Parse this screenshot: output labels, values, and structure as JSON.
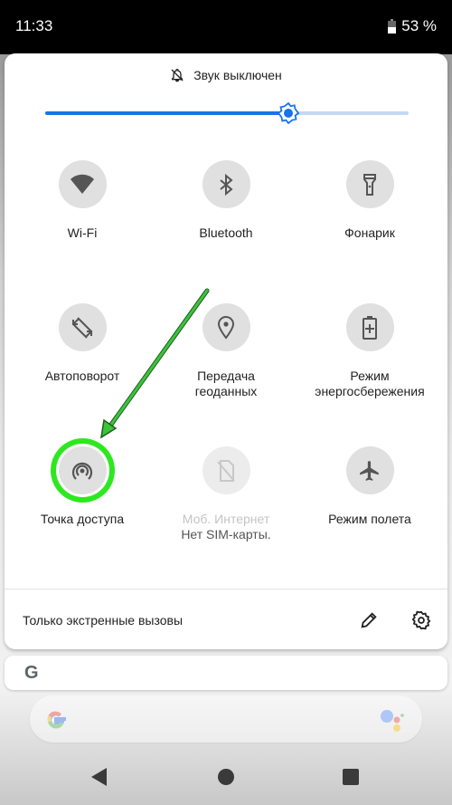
{
  "status_bar": {
    "time": "11:33",
    "battery_percent_label": "53 %",
    "battery_level": 0.53
  },
  "quick_settings": {
    "sound_status": "Звук выключен",
    "brightness": 0.67,
    "accent_color": "#1a73e8",
    "tiles": [
      {
        "id": "wifi",
        "label": "Wi-Fi",
        "icon": "wifi-icon",
        "state": "off"
      },
      {
        "id": "bluetooth",
        "label": "Bluetooth",
        "icon": "bluetooth-icon",
        "state": "off"
      },
      {
        "id": "flashlight",
        "label": "Фонарик",
        "icon": "flashlight-icon",
        "state": "off"
      },
      {
        "id": "autorotate",
        "label": "Автоповорот",
        "icon": "autorotate-icon",
        "state": "off"
      },
      {
        "id": "location",
        "label": "Передача геоданных",
        "label_line1": "Передача",
        "label_line2": "геоданных",
        "icon": "location-icon",
        "state": "off"
      },
      {
        "id": "battery-saver",
        "label": "Режим энергосбережения",
        "label_line1": "Режим",
        "label_line2": "энергосбережения",
        "icon": "battery-saver-icon",
        "state": "off"
      },
      {
        "id": "hotspot",
        "label": "Точка доступа",
        "icon": "hotspot-icon",
        "state": "off",
        "highlighted": true
      },
      {
        "id": "mobile-data",
        "label": "Моб. Интернет",
        "sublabel": "Нет SIM-карты.",
        "icon": "no-sim-icon",
        "state": "disabled"
      },
      {
        "id": "airplane",
        "label": "Режим полета",
        "icon": "airplane-icon",
        "state": "off"
      }
    ],
    "footer_text": "Только экстренные вызовы",
    "highlight_color": "#2ee81f",
    "annotation_arrow_color": "#2aa52a"
  },
  "search_card": {
    "logo_letter": "G"
  },
  "navigation": {
    "back": "back-button",
    "home": "home-button",
    "recents": "recents-button"
  }
}
